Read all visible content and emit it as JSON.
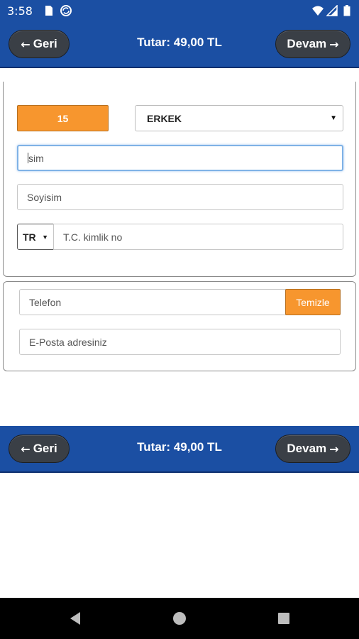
{
  "status_bar": {
    "time": "3:58",
    "icons": [
      "sd-card-icon",
      "sync-icon",
      "wifi-icon",
      "signal-icon",
      "battery-icon"
    ]
  },
  "top_nav": {
    "back_label": "Geri",
    "back_arrow": "←",
    "total": "Tutar: 49,00 TL",
    "next_label": "Devam",
    "next_arrow": "→"
  },
  "form": {
    "age": "15",
    "gender": {
      "selected": "ERKEK"
    },
    "first_name": {
      "placeholder": "İsim",
      "placeholder_rest": "sim"
    },
    "last_name": {
      "placeholder": "Soyisim"
    },
    "nationality": {
      "selected": "TR"
    },
    "id_number": {
      "placeholder": "T.C. kimlik no"
    },
    "phone": {
      "placeholder": "Telefon",
      "clear_label": "Temizle"
    },
    "email": {
      "placeholder": "E-Posta adresiniz"
    }
  },
  "bottom_nav": {
    "back_label": "Geri",
    "back_arrow": "←",
    "total": "Tutar: 49,00 TL",
    "next_label": "Devam",
    "next_arrow": "→"
  },
  "colors": {
    "nav_blue": "#1b4fa3",
    "accent_orange": "#f7962e",
    "button_dark": "#3a3f46"
  }
}
